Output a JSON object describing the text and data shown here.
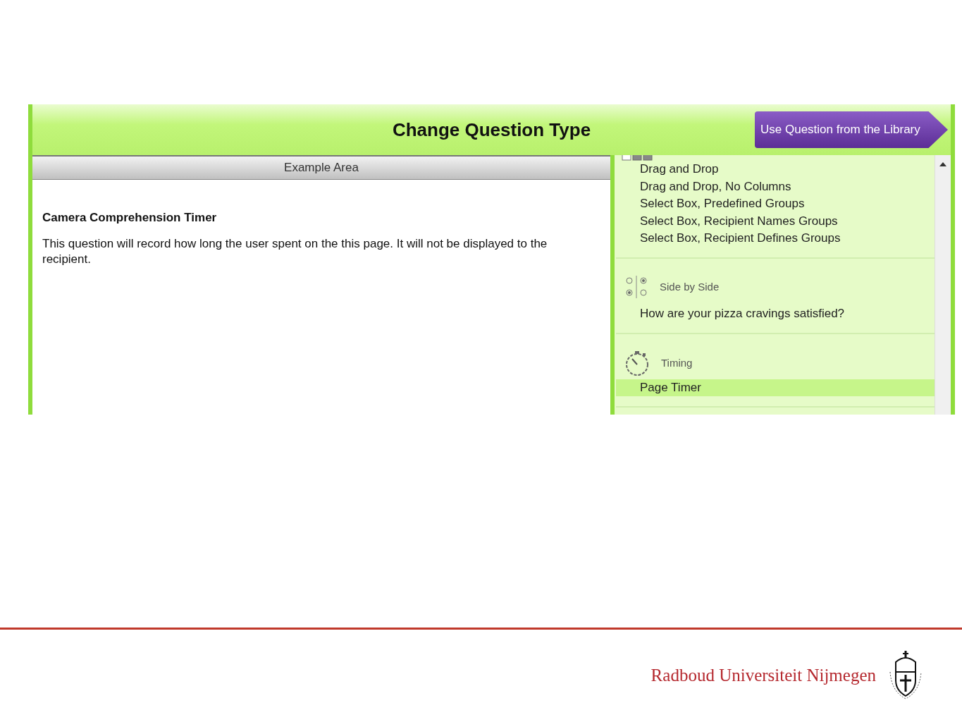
{
  "header": {
    "title": "Change Question Type",
    "library_button": "Use Question from the Library"
  },
  "example_area": {
    "heading": "Example Area",
    "question_title": "Camera Comprehension Timer",
    "description": "This question will record how long the user spent on the this page. It will not be displayed to the recipient."
  },
  "question_types": [
    {
      "kind": "checkboxes",
      "items": [
        {
          "label": "Drag and Drop",
          "selected": false
        },
        {
          "label": "Drag and Drop, No Columns",
          "selected": false
        },
        {
          "label": "Select Box, Predefined Groups",
          "selected": false
        },
        {
          "label": "Select Box, Recipient Names Groups",
          "selected": false
        },
        {
          "label": "Select Box, Recipient Defines Groups",
          "selected": false
        }
      ]
    },
    {
      "kind": "side-by-side",
      "label": "Side by Side",
      "items": [
        {
          "label": "How are your pizza cravings satisfied?",
          "selected": false
        }
      ]
    },
    {
      "kind": "timing",
      "label": "Timing",
      "items": [
        {
          "label": "Page Timer",
          "selected": true
        }
      ]
    }
  ],
  "footer": {
    "university": "Radboud Universiteit Nijmegen"
  }
}
